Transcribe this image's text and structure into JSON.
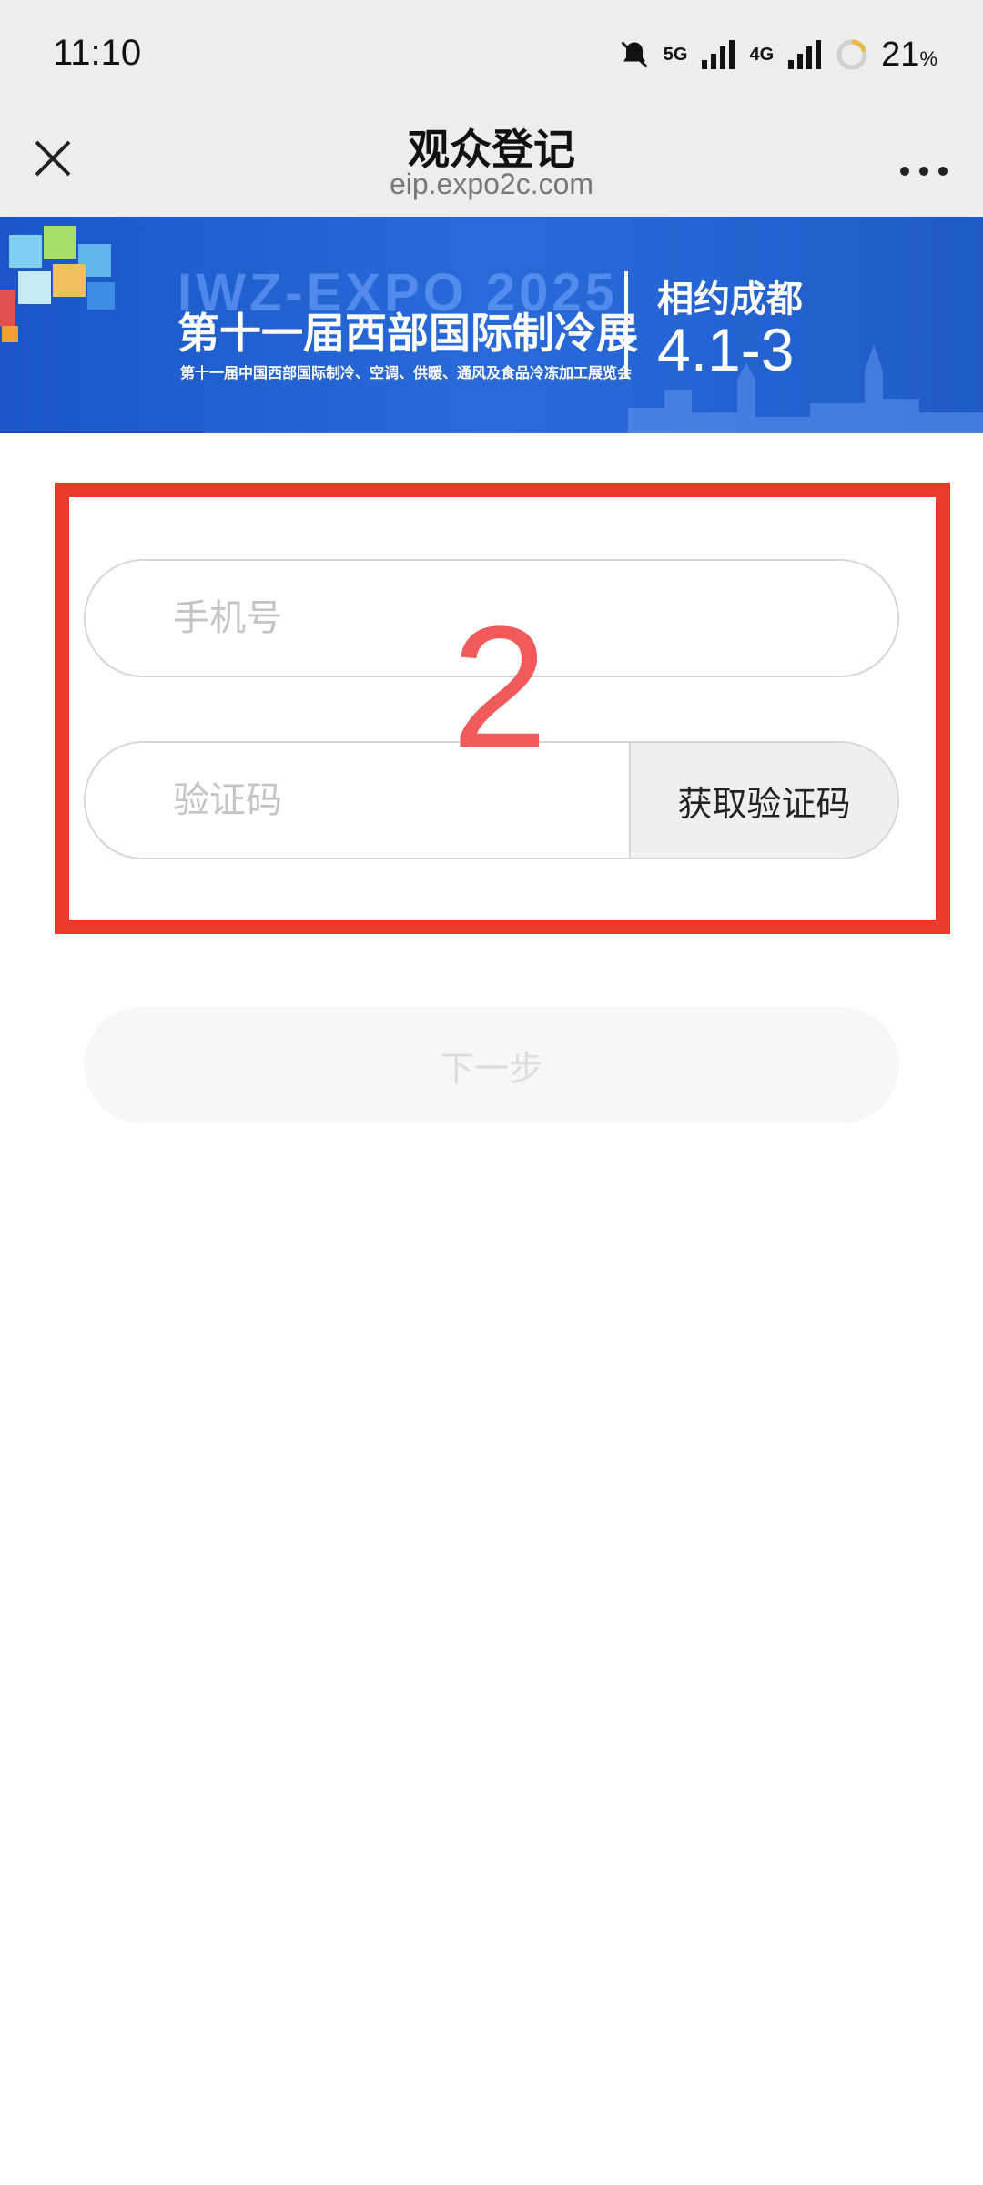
{
  "status_bar": {
    "time": "11:10",
    "network_1": "5G",
    "network_2": "4G",
    "battery": "21",
    "battery_unit": "%"
  },
  "title_bar": {
    "title": "观众登记",
    "url": "eip.expo2c.com"
  },
  "banner": {
    "expo_name": "IWZ-EXPO 2025",
    "title": "第十一届西部国际制冷展",
    "subtitle": "第十一届中国西部国际制冷、空调、供暖、通风及食品冷冻加工展览会",
    "city": "相约成都",
    "dates": "4.1-3"
  },
  "annotation": {
    "step_number": "2",
    "highlight_color": "#ee3a2a"
  },
  "form": {
    "phone_placeholder": "手机号",
    "code_placeholder": "验证码",
    "get_code_label": "获取验证码",
    "next_label": "下一步"
  },
  "icons": [
    "close-icon",
    "more-icon",
    "mute-bell-icon",
    "signal-icon",
    "battery-ring-icon"
  ]
}
